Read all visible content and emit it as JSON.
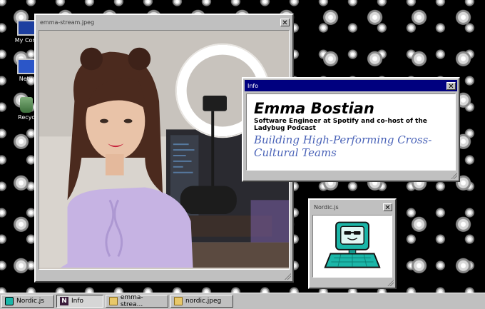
{
  "desktop": {
    "icons": [
      {
        "label": "My Com",
        "icon": "computer-icon"
      },
      {
        "label": "Netw",
        "icon": "network-icon"
      },
      {
        "label": "Recyc",
        "icon": "recycle-bin-icon"
      }
    ]
  },
  "windows": {
    "photo": {
      "title": "emma-stream.jpeg"
    },
    "info": {
      "title": "Info",
      "name": "Emma Bostian",
      "role": "Software Engineer at Spotify and co-host of the Ladybug Podcast",
      "talk": "Building High-Performing Cross-Cultural Teams"
    },
    "nordic": {
      "title": "Nordic.js"
    }
  },
  "taskbar": {
    "items": [
      {
        "label": "Nordic.js",
        "icon": "nordic-icon",
        "pressed": false
      },
      {
        "label": "Info",
        "icon": "info-icon",
        "pressed": true
      },
      {
        "label": "emma-strea...",
        "icon": "folder-icon",
        "pressed": false
      },
      {
        "label": "nordic.jpeg",
        "icon": "folder-icon",
        "pressed": false
      }
    ]
  },
  "colors": {
    "title_active": "#00007f",
    "window_face": "#c0c0c0",
    "talk_blue": "#4a63b8",
    "computer_teal": "#1bb6a8"
  }
}
